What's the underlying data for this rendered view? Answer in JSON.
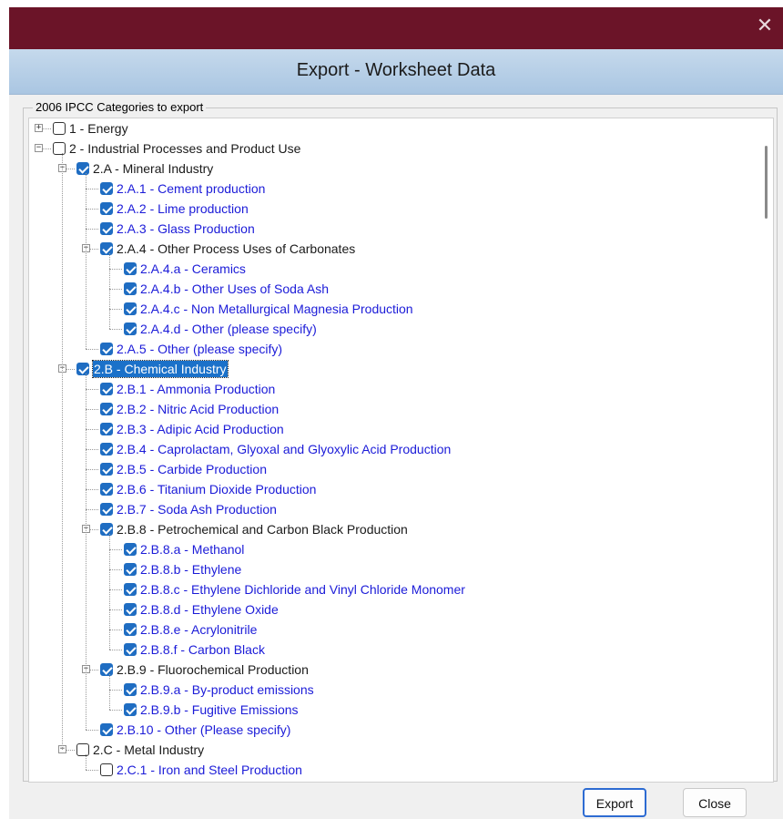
{
  "window": {
    "close_glyph": "✕",
    "dialog_title": "Export - Worksheet Data"
  },
  "group": {
    "legend": "2006 IPCC Categories to export"
  },
  "tree": {
    "nodes": [
      {
        "label": "1 - Energy",
        "level": 0,
        "expander": "+",
        "checked": false,
        "style": "cat"
      },
      {
        "label": "2 - Industrial Processes and Product Use",
        "level": 0,
        "expander": "−",
        "checked": false,
        "style": "cat"
      },
      {
        "label": "2.A - Mineral Industry",
        "level": 1,
        "expander": "−",
        "checked": true,
        "style": "cat"
      },
      {
        "label": "2.A.1 - Cement production",
        "level": 2,
        "expander": "",
        "checked": true,
        "style": "leaf"
      },
      {
        "label": "2.A.2 - Lime production",
        "level": 2,
        "expander": "",
        "checked": true,
        "style": "leaf"
      },
      {
        "label": "2.A.3 - Glass Production",
        "level": 2,
        "expander": "",
        "checked": true,
        "style": "leaf"
      },
      {
        "label": "2.A.4 - Other Process Uses of Carbonates",
        "level": 2,
        "expander": "−",
        "checked": true,
        "style": "cat"
      },
      {
        "label": "2.A.4.a - Ceramics",
        "level": 3,
        "expander": "",
        "checked": true,
        "style": "leaf"
      },
      {
        "label": "2.A.4.b - Other Uses of Soda Ash",
        "level": 3,
        "expander": "",
        "checked": true,
        "style": "leaf"
      },
      {
        "label": "2.A.4.c - Non Metallurgical Magnesia Production",
        "level": 3,
        "expander": "",
        "checked": true,
        "style": "leaf"
      },
      {
        "label": "2.A.4.d - Other (please specify)",
        "level": 3,
        "expander": "",
        "checked": true,
        "style": "leaf"
      },
      {
        "label": "2.A.5 - Other (please specify)",
        "level": 2,
        "expander": "",
        "checked": true,
        "style": "leaf"
      },
      {
        "label": "2.B - Chemical Industry",
        "level": 1,
        "expander": "−",
        "checked": true,
        "style": "selected"
      },
      {
        "label": "2.B.1 - Ammonia Production",
        "level": 2,
        "expander": "",
        "checked": true,
        "style": "leaf"
      },
      {
        "label": "2.B.2 - Nitric Acid Production",
        "level": 2,
        "expander": "",
        "checked": true,
        "style": "leaf"
      },
      {
        "label": "2.B.3 - Adipic Acid Production",
        "level": 2,
        "expander": "",
        "checked": true,
        "style": "leaf"
      },
      {
        "label": "2.B.4 - Caprolactam, Glyoxal and Glyoxylic Acid Production",
        "level": 2,
        "expander": "",
        "checked": true,
        "style": "leaf"
      },
      {
        "label": "2.B.5 - Carbide Production",
        "level": 2,
        "expander": "",
        "checked": true,
        "style": "leaf"
      },
      {
        "label": "2.B.6 - Titanium Dioxide Production",
        "level": 2,
        "expander": "",
        "checked": true,
        "style": "leaf"
      },
      {
        "label": "2.B.7 - Soda Ash Production",
        "level": 2,
        "expander": "",
        "checked": true,
        "style": "leaf"
      },
      {
        "label": "2.B.8 - Petrochemical and Carbon Black Production",
        "level": 2,
        "expander": "−",
        "checked": true,
        "style": "cat"
      },
      {
        "label": "2.B.8.a - Methanol",
        "level": 3,
        "expander": "",
        "checked": true,
        "style": "leaf"
      },
      {
        "label": "2.B.8.b - Ethylene",
        "level": 3,
        "expander": "",
        "checked": true,
        "style": "leaf"
      },
      {
        "label": "2.B.8.c - Ethylene Dichloride and Vinyl Chloride Monomer",
        "level": 3,
        "expander": "",
        "checked": true,
        "style": "leaf"
      },
      {
        "label": "2.B.8.d - Ethylene Oxide",
        "level": 3,
        "expander": "",
        "checked": true,
        "style": "leaf"
      },
      {
        "label": "2.B.8.e - Acrylonitrile",
        "level": 3,
        "expander": "",
        "checked": true,
        "style": "leaf"
      },
      {
        "label": "2.B.8.f - Carbon Black",
        "level": 3,
        "expander": "",
        "checked": true,
        "style": "leaf"
      },
      {
        "label": "2.B.9 - Fluorochemical Production",
        "level": 2,
        "expander": "−",
        "checked": true,
        "style": "cat"
      },
      {
        "label": "2.B.9.a - By-product emissions",
        "level": 3,
        "expander": "",
        "checked": true,
        "style": "leaf"
      },
      {
        "label": "2.B.9.b - Fugitive Emissions",
        "level": 3,
        "expander": "",
        "checked": true,
        "style": "leaf"
      },
      {
        "label": "2.B.10 - Other (Please specify)",
        "level": 2,
        "expander": "",
        "checked": true,
        "style": "leaf"
      },
      {
        "label": "2.C - Metal Industry",
        "level": 1,
        "expander": "−",
        "checked": false,
        "style": "cat"
      },
      {
        "label": "2.C.1 - Iron and Steel Production",
        "level": 2,
        "expander": "",
        "checked": false,
        "style": "leaf"
      }
    ]
  },
  "buttons": {
    "export_label": "Export",
    "close_label": "Close"
  },
  "colors": {
    "titlebar": "#6b1428",
    "check_accent": "#1f6dc2",
    "leaf_text": "#1b1bd8",
    "selection": "#1b71c9"
  }
}
